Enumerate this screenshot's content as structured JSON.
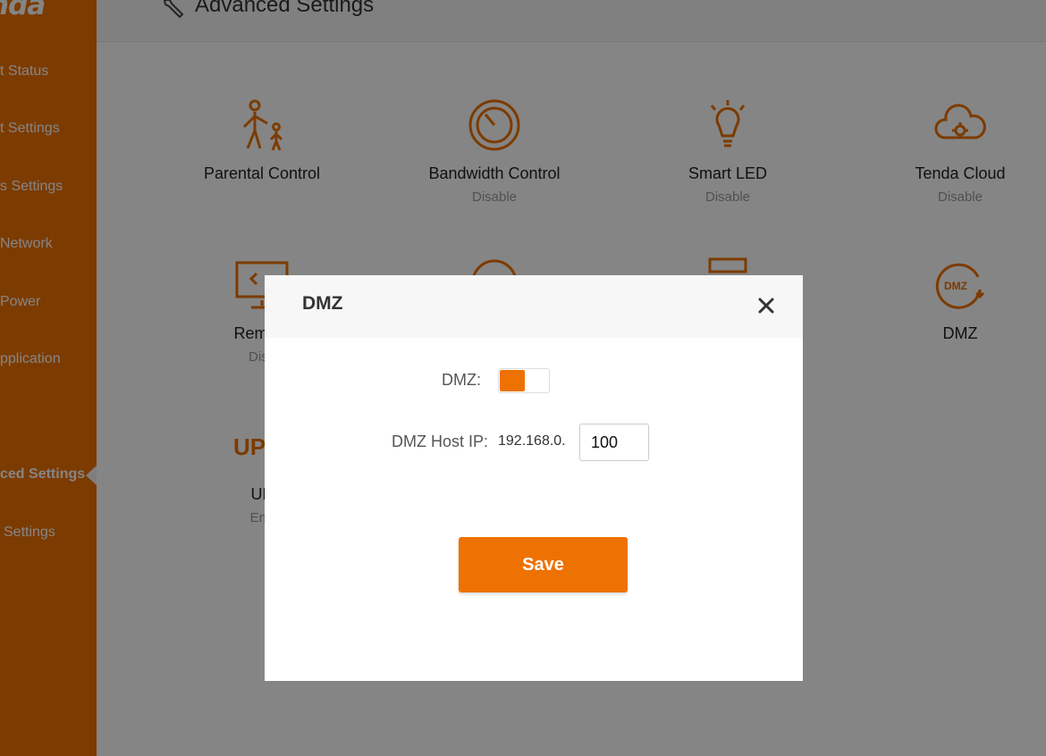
{
  "brand": {
    "logo_text": "nda",
    "accent": "#ee7202"
  },
  "sidebar": {
    "items": [
      {
        "label": "t Status"
      },
      {
        "label": "t Settings"
      },
      {
        "label": "s Settings"
      },
      {
        "label": "Network"
      },
      {
        "label": "Power"
      },
      {
        "label": "pplication"
      },
      {
        "label": "ced Settings",
        "active": true
      },
      {
        "label": "Settings"
      }
    ]
  },
  "header": {
    "title": "Advanced Settings",
    "icon": "wrench-icon"
  },
  "tiles": [
    {
      "name": "Parental Control",
      "state": "",
      "icon": "parental-icon"
    },
    {
      "name": "Bandwidth Control",
      "state": "Disable",
      "icon": "speedometer-icon"
    },
    {
      "name": "Smart LED",
      "state": "Disable",
      "icon": "bulb-icon"
    },
    {
      "name": "Tenda Cloud",
      "state": "Disable",
      "icon": "cloud-gear-icon"
    },
    {
      "name": "Remote",
      "state": "Disa",
      "icon": "monitor-icon"
    },
    {
      "name": "DMZ",
      "state": "",
      "icon": "dmz-icon"
    },
    {
      "name": "UP",
      "state": "Ena",
      "icon": "upnp-icon"
    }
  ],
  "modal": {
    "title": "DMZ",
    "close_icon": "close-icon",
    "dmz_label": "DMZ:",
    "dmz_enabled": true,
    "host_ip_label": "DMZ Host IP:",
    "ip_prefix": "192.168.0.",
    "ip_last_octet": "100",
    "save_label": "Save"
  }
}
